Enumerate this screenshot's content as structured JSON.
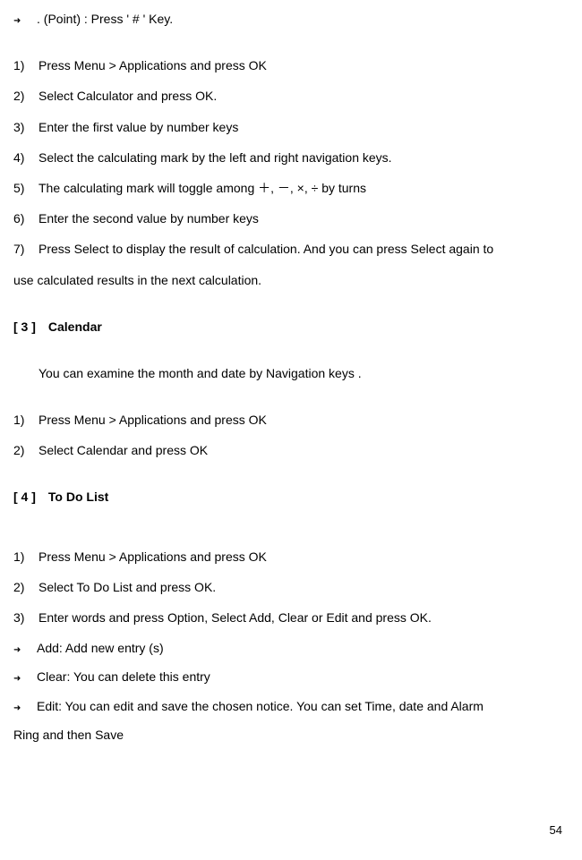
{
  "top_bullet": ". (Point) : Press ' # ' Key.",
  "calc_steps": {
    "1": "Press Menu > Applications and press OK",
    "2": "Select Calculator and press OK.",
    "3": "Enter the first value by number keys",
    "4": "Select the calculating mark by the left and right navigation keys.",
    "5": "The calculating mark will toggle among ＋, －, ×, ÷  by turns",
    "6": "Enter the second value by number keys",
    "7_part1": "Press Select to display the result of calculation. And you can press Select again to",
    "7_part2": "use calculated results in the next calculation."
  },
  "section3": {
    "num": "[ 3 ]",
    "title": "Calendar",
    "intro": "You can examine the month and date by Navigation keys   .",
    "steps": {
      "1": "Press Menu > Applications and press OK",
      "2": "Select Calendar and press OK"
    }
  },
  "section4": {
    "num": "[ 4 ]",
    "title": "To Do List",
    "steps": {
      "1": "Press Menu > Applications and press OK",
      "2": "Select To Do List and press OK.",
      "3": "Enter words and press Option, Select Add, Clear or Edit and press OK."
    },
    "bullets": {
      "add": "Add: Add new entry (s)",
      "clear": "Clear: You can delete this entry",
      "edit_part1": "Edit: You can edit and save the chosen notice. You can set Time, date and Alarm",
      "edit_part2": "Ring and then Save"
    }
  },
  "page_number": "54"
}
